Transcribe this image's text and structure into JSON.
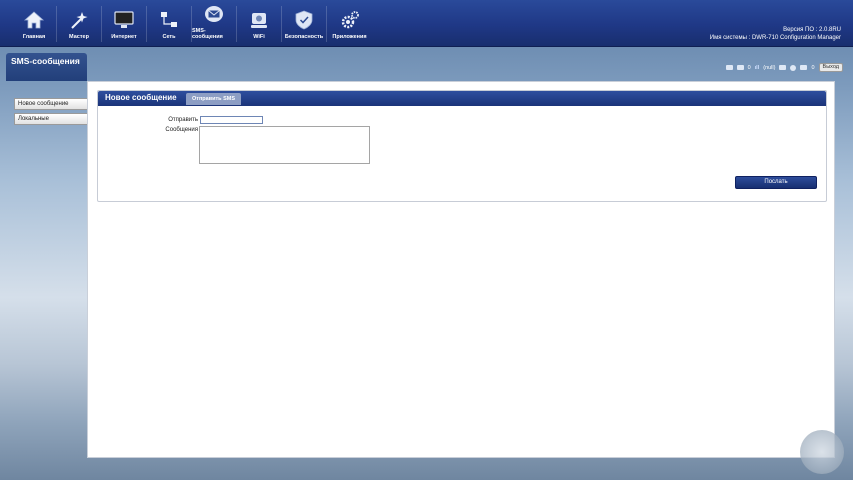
{
  "nav": {
    "items": [
      {
        "label": "Главная",
        "icon": "home-icon"
      },
      {
        "label": "Мастер",
        "icon": "wizard-icon"
      },
      {
        "label": "Интернет",
        "icon": "monitor-icon"
      },
      {
        "label": "Сеть",
        "icon": "network-icon"
      },
      {
        "label": "SMS-сообщения",
        "icon": "envelope-icon"
      },
      {
        "label": "WiFi",
        "icon": "wifi-router-icon"
      },
      {
        "label": "Безопасность",
        "icon": "shield-icon"
      },
      {
        "label": "Приложения",
        "icon": "gears-icon"
      }
    ]
  },
  "firmware": {
    "version_line": "Версия ПО : 2.0.8RU",
    "system_line": "Имя системы : DWR-710 Configuration Manager"
  },
  "status": {
    "sms_count": "0",
    "signal": "(null)",
    "msg_count": "0",
    "logout_label": "Выход"
  },
  "sidebar": {
    "title": "SMS-сообщения",
    "items": [
      {
        "label": "Новое сообщение"
      },
      {
        "label": "Локальные"
      }
    ]
  },
  "panel": {
    "title": "Новое сообщение",
    "tab_label": "Отправить SMS",
    "to_label": "Отправить",
    "to_value": "",
    "message_label": "Сообщения",
    "message_value": "",
    "send_label": "Послать"
  },
  "colors": {
    "header_blue": "#1f3886",
    "tab_grey_blue": "#8d9ec4"
  }
}
